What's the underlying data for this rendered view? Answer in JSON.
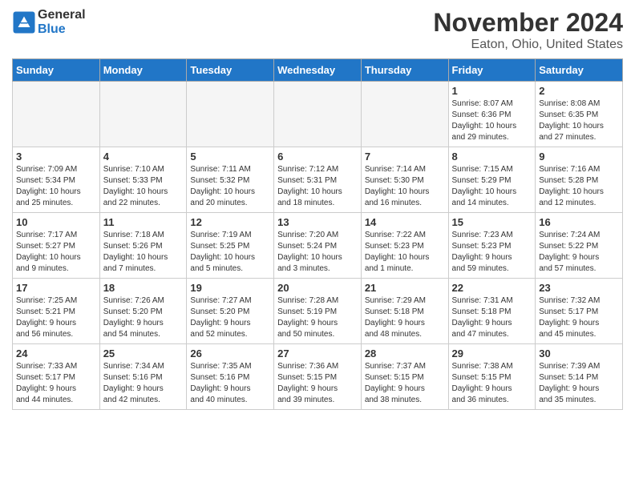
{
  "logo": {
    "general": "General",
    "blue": "Blue"
  },
  "title": "November 2024",
  "subtitle": "Eaton, Ohio, United States",
  "days_of_week": [
    "Sunday",
    "Monday",
    "Tuesday",
    "Wednesday",
    "Thursday",
    "Friday",
    "Saturday"
  ],
  "weeks": [
    [
      {
        "num": "",
        "info": "",
        "empty": true
      },
      {
        "num": "",
        "info": "",
        "empty": true
      },
      {
        "num": "",
        "info": "",
        "empty": true
      },
      {
        "num": "",
        "info": "",
        "empty": true
      },
      {
        "num": "",
        "info": "",
        "empty": true
      },
      {
        "num": "1",
        "info": "Sunrise: 8:07 AM\nSunset: 6:36 PM\nDaylight: 10 hours\nand 29 minutes."
      },
      {
        "num": "2",
        "info": "Sunrise: 8:08 AM\nSunset: 6:35 PM\nDaylight: 10 hours\nand 27 minutes."
      }
    ],
    [
      {
        "num": "3",
        "info": "Sunrise: 7:09 AM\nSunset: 5:34 PM\nDaylight: 10 hours\nand 25 minutes."
      },
      {
        "num": "4",
        "info": "Sunrise: 7:10 AM\nSunset: 5:33 PM\nDaylight: 10 hours\nand 22 minutes."
      },
      {
        "num": "5",
        "info": "Sunrise: 7:11 AM\nSunset: 5:32 PM\nDaylight: 10 hours\nand 20 minutes."
      },
      {
        "num": "6",
        "info": "Sunrise: 7:12 AM\nSunset: 5:31 PM\nDaylight: 10 hours\nand 18 minutes."
      },
      {
        "num": "7",
        "info": "Sunrise: 7:14 AM\nSunset: 5:30 PM\nDaylight: 10 hours\nand 16 minutes."
      },
      {
        "num": "8",
        "info": "Sunrise: 7:15 AM\nSunset: 5:29 PM\nDaylight: 10 hours\nand 14 minutes."
      },
      {
        "num": "9",
        "info": "Sunrise: 7:16 AM\nSunset: 5:28 PM\nDaylight: 10 hours\nand 12 minutes."
      }
    ],
    [
      {
        "num": "10",
        "info": "Sunrise: 7:17 AM\nSunset: 5:27 PM\nDaylight: 10 hours\nand 9 minutes."
      },
      {
        "num": "11",
        "info": "Sunrise: 7:18 AM\nSunset: 5:26 PM\nDaylight: 10 hours\nand 7 minutes."
      },
      {
        "num": "12",
        "info": "Sunrise: 7:19 AM\nSunset: 5:25 PM\nDaylight: 10 hours\nand 5 minutes."
      },
      {
        "num": "13",
        "info": "Sunrise: 7:20 AM\nSunset: 5:24 PM\nDaylight: 10 hours\nand 3 minutes."
      },
      {
        "num": "14",
        "info": "Sunrise: 7:22 AM\nSunset: 5:23 PM\nDaylight: 10 hours\nand 1 minute."
      },
      {
        "num": "15",
        "info": "Sunrise: 7:23 AM\nSunset: 5:23 PM\nDaylight: 9 hours\nand 59 minutes."
      },
      {
        "num": "16",
        "info": "Sunrise: 7:24 AM\nSunset: 5:22 PM\nDaylight: 9 hours\nand 57 minutes."
      }
    ],
    [
      {
        "num": "17",
        "info": "Sunrise: 7:25 AM\nSunset: 5:21 PM\nDaylight: 9 hours\nand 56 minutes."
      },
      {
        "num": "18",
        "info": "Sunrise: 7:26 AM\nSunset: 5:20 PM\nDaylight: 9 hours\nand 54 minutes."
      },
      {
        "num": "19",
        "info": "Sunrise: 7:27 AM\nSunset: 5:20 PM\nDaylight: 9 hours\nand 52 minutes."
      },
      {
        "num": "20",
        "info": "Sunrise: 7:28 AM\nSunset: 5:19 PM\nDaylight: 9 hours\nand 50 minutes."
      },
      {
        "num": "21",
        "info": "Sunrise: 7:29 AM\nSunset: 5:18 PM\nDaylight: 9 hours\nand 48 minutes."
      },
      {
        "num": "22",
        "info": "Sunrise: 7:31 AM\nSunset: 5:18 PM\nDaylight: 9 hours\nand 47 minutes."
      },
      {
        "num": "23",
        "info": "Sunrise: 7:32 AM\nSunset: 5:17 PM\nDaylight: 9 hours\nand 45 minutes."
      }
    ],
    [
      {
        "num": "24",
        "info": "Sunrise: 7:33 AM\nSunset: 5:17 PM\nDaylight: 9 hours\nand 44 minutes."
      },
      {
        "num": "25",
        "info": "Sunrise: 7:34 AM\nSunset: 5:16 PM\nDaylight: 9 hours\nand 42 minutes."
      },
      {
        "num": "26",
        "info": "Sunrise: 7:35 AM\nSunset: 5:16 PM\nDaylight: 9 hours\nand 40 minutes."
      },
      {
        "num": "27",
        "info": "Sunrise: 7:36 AM\nSunset: 5:15 PM\nDaylight: 9 hours\nand 39 minutes."
      },
      {
        "num": "28",
        "info": "Sunrise: 7:37 AM\nSunset: 5:15 PM\nDaylight: 9 hours\nand 38 minutes."
      },
      {
        "num": "29",
        "info": "Sunrise: 7:38 AM\nSunset: 5:15 PM\nDaylight: 9 hours\nand 36 minutes."
      },
      {
        "num": "30",
        "info": "Sunrise: 7:39 AM\nSunset: 5:14 PM\nDaylight: 9 hours\nand 35 minutes."
      }
    ]
  ]
}
